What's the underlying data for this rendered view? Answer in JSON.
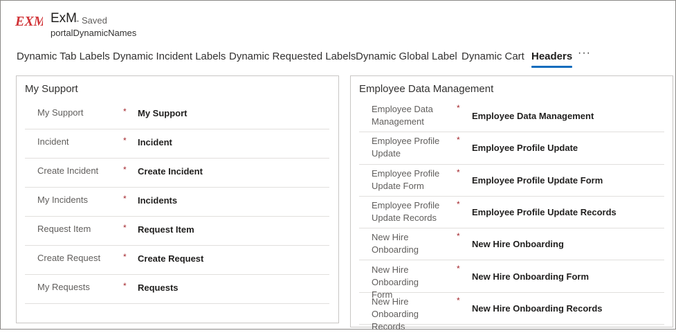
{
  "app": {
    "logo_text": "EXM",
    "title": "ExM",
    "status": "- Saved",
    "entity": "portalDynamicNames"
  },
  "tabs": [
    {
      "label": "Dynamic Tab Labels"
    },
    {
      "label": "Dynamic Incident Labels"
    },
    {
      "label": "Dynamic Requested Labels"
    },
    {
      "label": "Dynamic Global Label"
    },
    {
      "label": "Dynamic Cart"
    },
    {
      "label": "Headers",
      "active": true
    }
  ],
  "more_label": "···",
  "sections": {
    "left": {
      "title": "My Support",
      "rows": [
        {
          "label": "My Support",
          "required": "*",
          "value": "My Support"
        },
        {
          "label": "Incident",
          "required": "*",
          "value": "Incident"
        },
        {
          "label": "Create Incident",
          "required": "*",
          "value": "Create Incident"
        },
        {
          "label": "My Incidents",
          "required": "*",
          "value": "Incidents"
        },
        {
          "label": "Request Item",
          "required": "*",
          "value": "Request Item"
        },
        {
          "label": "Create Request",
          "required": "*",
          "value": "Create Request"
        },
        {
          "label": "My Requests",
          "required": "*",
          "value": "Requests"
        }
      ]
    },
    "right": {
      "title": "Employee Data Management",
      "rows": [
        {
          "label": "Employee Data Management",
          "required": "*",
          "value": "Employee Data Management"
        },
        {
          "label": "Employee Profile Update",
          "required": "*",
          "value": "Employee Profile Update"
        },
        {
          "label": "Employee Profile Update Form",
          "required": "*",
          "value": "Employee Profile Update Form"
        },
        {
          "label": "Employee Profile Update Records",
          "required": "*",
          "value": "Employee Profile Update Records"
        },
        {
          "label": "New Hire Onboarding",
          "required": "*",
          "value": "New Hire Onboarding"
        },
        {
          "label": "New Hire Onboarding Form",
          "required": "*",
          "value": "New Hire Onboarding Form"
        },
        {
          "label": "New Hire Onboarding Records",
          "required": "*",
          "value": "New Hire Onboarding Records"
        }
      ]
    }
  },
  "colors": {
    "accent": "#0f6cbd",
    "required": "#a4262c",
    "logo_red": "#d13438"
  }
}
